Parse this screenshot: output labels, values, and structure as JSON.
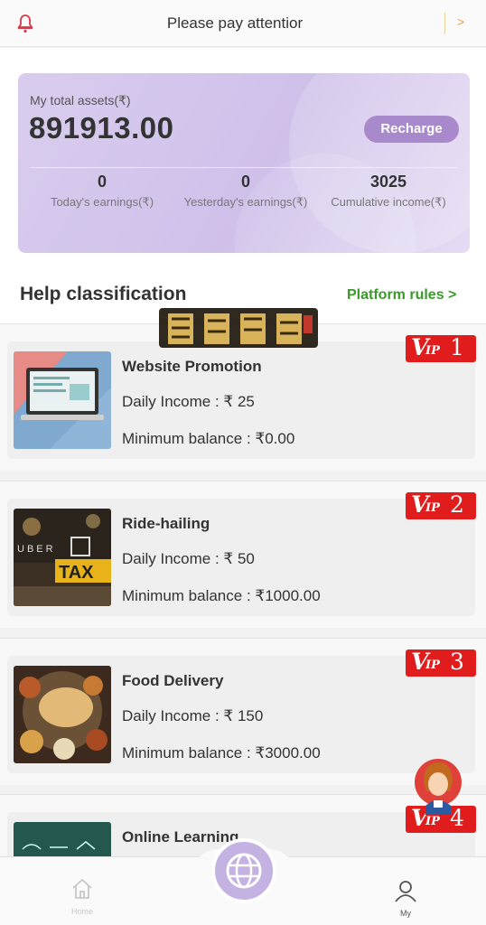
{
  "notice": {
    "message": "Please pay attentior",
    "more": ">"
  },
  "assets": {
    "label": "My total assets(₹)",
    "total": "891913.00",
    "recharge_label": "Recharge",
    "stats": [
      {
        "value": "0",
        "label": "Today's earnings(₹)"
      },
      {
        "value": "0",
        "label": "Yesterday's earnings(₹)"
      },
      {
        "value": "3025",
        "label": "Cumulative income(₹)"
      }
    ]
  },
  "section": {
    "title": "Help classification",
    "rules_link": "Platform rules >"
  },
  "tasks": [
    {
      "title": "Website Promotion",
      "income": "Daily Income : ₹ 25",
      "min_balance": "Minimum balance : ₹0.00",
      "vip": "1"
    },
    {
      "title": "Ride-hailing",
      "income": "Daily Income : ₹ 50",
      "min_balance": "Minimum balance : ₹1000.00",
      "vip": "2"
    },
    {
      "title": "Food Delivery",
      "income": "Daily Income : ₹ 150",
      "min_balance": "Minimum balance : ₹3000.00",
      "vip": "3"
    },
    {
      "title": "Online Learning",
      "income": "",
      "min_balance": "",
      "vip": "4"
    }
  ],
  "vip_badge": {
    "v": "V",
    "ip": "IP"
  },
  "thumb_text": {
    "uber": "UBER",
    "taxi": "TAX"
  },
  "bottom_nav": {
    "home_label": "Home",
    "my_label": "My"
  },
  "colors": {
    "accent": "#a889cc",
    "vip_red": "#e01c1c",
    "rules_green": "#3a9a2a",
    "bell": "#e0374a"
  }
}
